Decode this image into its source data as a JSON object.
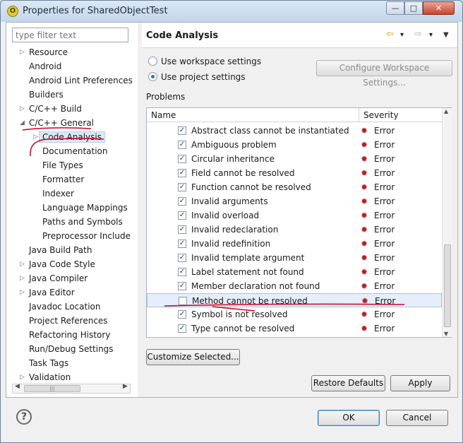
{
  "window": {
    "title": "Properties for SharedObjectTest",
    "app_icon_glyph": "O",
    "minimize_glyph": "—",
    "maximize_glyph": "□",
    "close_glyph": "✕"
  },
  "sidebar": {
    "filter_placeholder": "type filter text",
    "items": [
      {
        "label": "Resource",
        "expandable": true,
        "level": 0
      },
      {
        "label": "Android",
        "expandable": false,
        "level": 0
      },
      {
        "label": "Android Lint Preferences",
        "expandable": false,
        "level": 0
      },
      {
        "label": "Builders",
        "expandable": false,
        "level": 0
      },
      {
        "label": "C/C++ Build",
        "expandable": true,
        "level": 0
      },
      {
        "label": "C/C++ General",
        "expandable": true,
        "expanded": true,
        "level": 0
      },
      {
        "label": "Code Analysis",
        "expandable": true,
        "level": 1,
        "selected": true
      },
      {
        "label": "Documentation",
        "expandable": false,
        "level": 1
      },
      {
        "label": "File Types",
        "expandable": false,
        "level": 1
      },
      {
        "label": "Formatter",
        "expandable": false,
        "level": 1
      },
      {
        "label": "Indexer",
        "expandable": false,
        "level": 1
      },
      {
        "label": "Language Mappings",
        "expandable": false,
        "level": 1
      },
      {
        "label": "Paths and Symbols",
        "expandable": false,
        "level": 1
      },
      {
        "label": "Preprocessor Include",
        "expandable": false,
        "level": 1
      },
      {
        "label": "Java Build Path",
        "expandable": false,
        "level": 0
      },
      {
        "label": "Java Code Style",
        "expandable": true,
        "level": 0
      },
      {
        "label": "Java Compiler",
        "expandable": true,
        "level": 0
      },
      {
        "label": "Java Editor",
        "expandable": true,
        "level": 0
      },
      {
        "label": "Javadoc Location",
        "expandable": false,
        "level": 0
      },
      {
        "label": "Project References",
        "expandable": false,
        "level": 0
      },
      {
        "label": "Refactoring History",
        "expandable": false,
        "level": 0
      },
      {
        "label": "Run/Debug Settings",
        "expandable": false,
        "level": 0
      },
      {
        "label": "Task Tags",
        "expandable": false,
        "level": 0
      },
      {
        "label": "Validation",
        "expandable": true,
        "level": 0
      }
    ],
    "scroll_grip": "|||"
  },
  "main": {
    "page_title": "Code Analysis",
    "nav": {
      "back": "⇦",
      "back_menu": "▾",
      "forward": "⇨",
      "forward_menu": "▾",
      "view_menu": "▼"
    },
    "radio_workspace": "Use workspace settings",
    "radio_project": "Use project settings",
    "selected_radio": "project",
    "configure_button": "Configure Workspace Settings...",
    "problems_label": "Problems",
    "table": {
      "col_name": "Name",
      "col_severity": "Severity",
      "rows": [
        {
          "name": "Abstract class cannot be instantiated",
          "checked": true,
          "severity": "Error"
        },
        {
          "name": "Ambiguous problem",
          "checked": true,
          "severity": "Error"
        },
        {
          "name": "Circular inheritance",
          "checked": true,
          "severity": "Error"
        },
        {
          "name": "Field cannot be resolved",
          "checked": true,
          "severity": "Error"
        },
        {
          "name": "Function cannot be resolved",
          "checked": true,
          "severity": "Error"
        },
        {
          "name": "Invalid arguments",
          "checked": true,
          "severity": "Error"
        },
        {
          "name": "Invalid overload",
          "checked": true,
          "severity": "Error"
        },
        {
          "name": "Invalid redeclaration",
          "checked": true,
          "severity": "Error"
        },
        {
          "name": "Invalid redefinition",
          "checked": true,
          "severity": "Error"
        },
        {
          "name": "Invalid template argument",
          "checked": true,
          "severity": "Error"
        },
        {
          "name": "Label statement not found",
          "checked": true,
          "severity": "Error"
        },
        {
          "name": "Member declaration not found",
          "checked": true,
          "severity": "Error"
        },
        {
          "name": "Method cannot be resolved",
          "checked": false,
          "severity": "Error",
          "selected": true
        },
        {
          "name": "Symbol is not resolved",
          "checked": true,
          "severity": "Error"
        },
        {
          "name": "Type cannot be resolved",
          "checked": true,
          "severity": "Error"
        }
      ]
    },
    "customize_button": "Customize Selected...",
    "restore_button": "Restore Defaults",
    "apply_button": "Apply"
  },
  "footer": {
    "help_glyph": "?",
    "ok_button": "OK",
    "cancel_button": "Cancel"
  },
  "colors": {
    "annotation_red": "#d0021b",
    "error_icon": "#b22222"
  },
  "icons": {
    "severity": "bug-error-icon",
    "help": "help-icon",
    "check": "✓"
  }
}
